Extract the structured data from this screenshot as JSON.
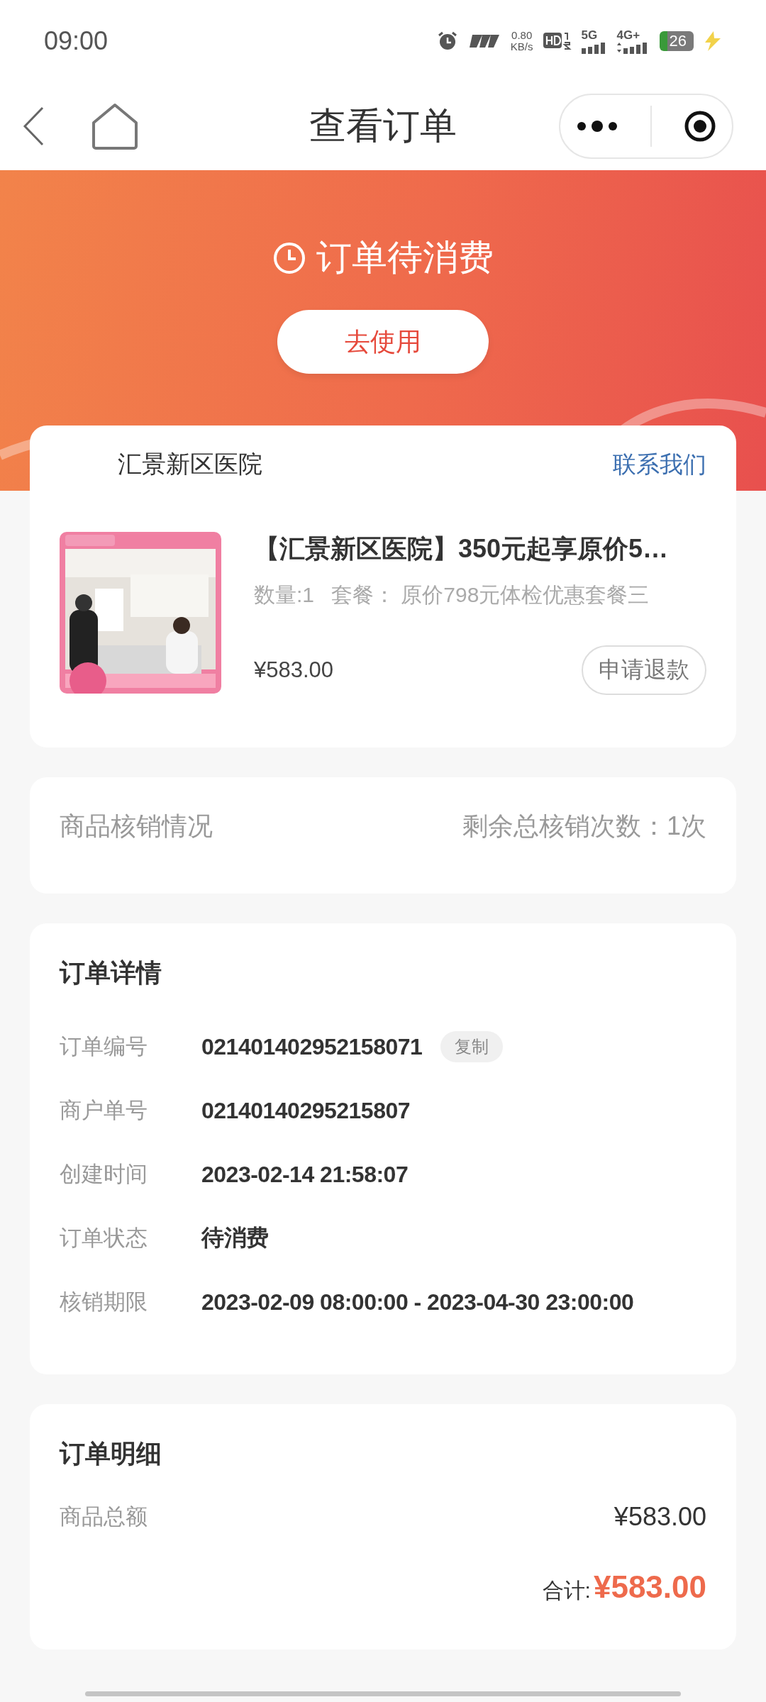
{
  "status_bar": {
    "time": "09:00",
    "net_speed": "0.80",
    "net_unit": "KB/s",
    "sim1": "5G",
    "sim2": "4G+",
    "battery": "26",
    "charging": true
  },
  "nav": {
    "title": "查看订单"
  },
  "header": {
    "status": "订单待消费",
    "action": "去使用"
  },
  "shop": {
    "name": "汇景新区医院",
    "contact": "联系我们"
  },
  "product": {
    "title": "【汇景新区医院】350元起享原价5…",
    "quantity": "数量:1",
    "package": "套餐： 原价798元体检优惠套餐三",
    "price": "¥583.00",
    "refund": "申请退款"
  },
  "verification": {
    "label": "商品核销情况",
    "remaining": "剩余总核销次数：1次"
  },
  "details": {
    "title": "订单详情",
    "rows": [
      {
        "label": "订单编号",
        "value": "021401402952158071",
        "copy": "复制"
      },
      {
        "label": "商户单号",
        "value": "02140140295215807"
      },
      {
        "label": "创建时间",
        "value": "2023-02-14 21:58:07"
      },
      {
        "label": "订单状态",
        "value": "待消费"
      },
      {
        "label": "核销期限",
        "value": "2023-02-09 08:00:00 - 2023-04-30 23:00:00"
      }
    ]
  },
  "summary": {
    "title": "订单明细",
    "rows": [
      {
        "label": "商品总额",
        "value": "¥583.00"
      }
    ],
    "total_label": "合计:",
    "total_value": "¥583.00"
  }
}
